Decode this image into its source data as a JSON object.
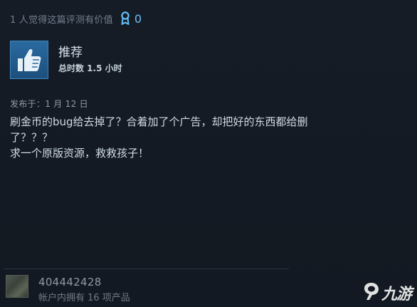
{
  "helpful": {
    "text": "1 人觉得这篇评测有价值",
    "award_icon": "award-ribbon-icon",
    "award_count": "0"
  },
  "recommendation": {
    "icon": "thumbs-up-icon",
    "title": "推荐",
    "hours": "总时数 1.5 小时"
  },
  "posted": "发布于：1 月 12 日",
  "review": {
    "lines": [
      "刷金币的bug给去掉了？合着加了个广告，却把好的东西都给删",
      "了？？？",
      "求一个原版资源，救救孩子！"
    ]
  },
  "author": {
    "name": "404442428",
    "products": "帐户内拥有 16 项产品"
  },
  "watermark": {
    "text": "九游",
    "logo": "jiuyou-logo-icon"
  },
  "colors": {
    "background": "#151b24",
    "accent": "#66c0f4",
    "thumb_box": "#2a6aa0"
  }
}
